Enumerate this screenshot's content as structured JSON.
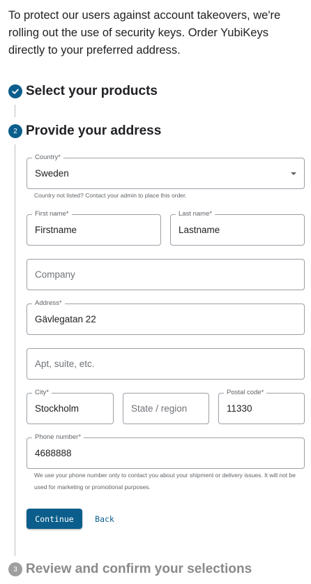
{
  "intro_text": "To protect our users against account takeovers, we're rolling out the use of security keys. Order YubiKeys directly to your preferred address.",
  "steps": [
    {
      "number": "",
      "title": "Select your products",
      "state": "completed"
    },
    {
      "number": "2",
      "title": "Provide your address",
      "state": "active"
    },
    {
      "number": "3",
      "title": "Review and confirm your selections",
      "state": "pending"
    }
  ],
  "form": {
    "country": {
      "label": "Country*",
      "value": "Sweden",
      "helper": "Country not listed? Contact your admin to place this order."
    },
    "first_name": {
      "label": "First name*",
      "value": "Firstname"
    },
    "last_name": {
      "label": "Last name*",
      "value": "Lastname"
    },
    "company": {
      "placeholder": "Company"
    },
    "address": {
      "label": "Address*",
      "value": "Gävlegatan 22"
    },
    "apt": {
      "placeholder": "Apt, suite, etc."
    },
    "city": {
      "label": "City*",
      "value": "Stockholm"
    },
    "state": {
      "placeholder": "State / region"
    },
    "postal_code": {
      "label": "Postal code*",
      "value": "11330"
    },
    "phone": {
      "label": "Phone number*",
      "value": "4688888",
      "helper": "We use your phone number only to contact you about your shipment or delivery issues. It will not be used for marketing or promotional purposes."
    }
  },
  "actions": {
    "continue_label": "Continue",
    "back_label": "Back"
  },
  "colors": {
    "accent": "#0b5e8c",
    "pending": "#9e9e9e",
    "border": "#9aa0a6"
  },
  "icons": {
    "completed_step": "check-icon",
    "country_select": "chevron-down-icon"
  }
}
